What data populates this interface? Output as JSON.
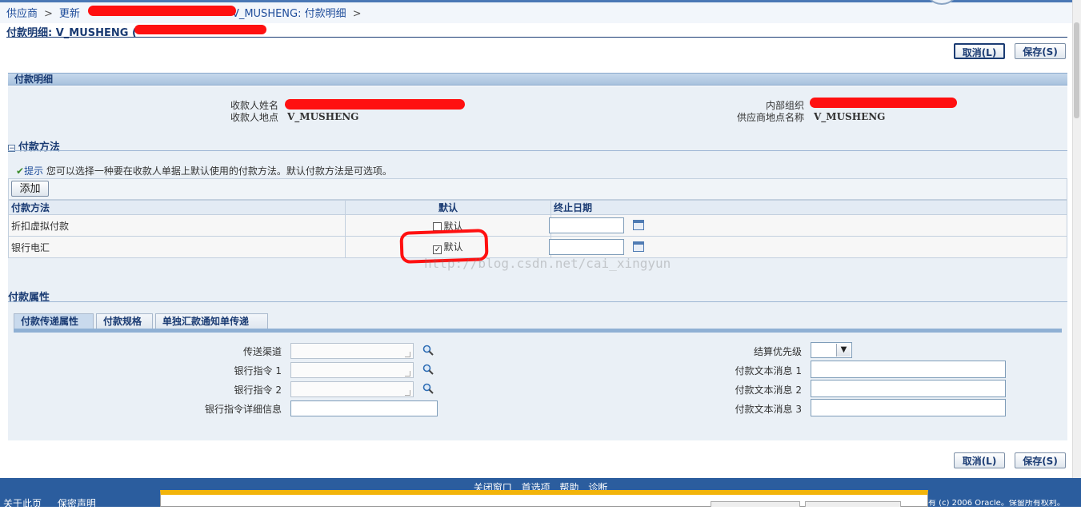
{
  "breadcrumb": {
    "items": [
      "供应商",
      "更新",
      "V_MUSHENG: 付款明细"
    ],
    "separator": ">"
  },
  "page": {
    "title": "付款明细: V_MUSHENG ("
  },
  "buttons": {
    "cancel": "取消(L)",
    "save": "保存(S)",
    "add": "添加"
  },
  "payment_detail": {
    "header": "付款明细",
    "payee_name_label": "收款人姓名",
    "payee_site_label": "收款人地点",
    "payee_site_value": "V_MUSHENG",
    "org_label": "内部组织",
    "supplier_site_label": "供应商地点名称",
    "supplier_site_value": "V_MUSHENG"
  },
  "payment_method": {
    "header": "付款方法",
    "tip_keyword": "提示",
    "tip_text": "您可以选择一种要在收款人单据上默认使用的付款方法。默认付款方法是可选项。",
    "columns": [
      "付款方法",
      "默认",
      "终止日期"
    ],
    "rows": [
      {
        "method": "折扣虚拟付款",
        "default_label": "默认",
        "checked": false
      },
      {
        "method": "银行电汇",
        "default_label": "默认",
        "checked": true
      }
    ]
  },
  "payment_attributes": {
    "header": "付款属性",
    "tabs": [
      "付款传递属性",
      "付款规格",
      "单独汇款通知单传递"
    ],
    "left_fields": [
      "传送渠道",
      "银行指令 1",
      "银行指令 2",
      "银行指令详细信息"
    ],
    "right_fields": [
      "结算优先级",
      "付款文本消息 1",
      "付款文本消息 2",
      "付款文本消息 3"
    ]
  },
  "footer": {
    "links": [
      "关闭窗口",
      "首选项",
      "帮助",
      "诊断"
    ],
    "left_links": [
      "关于此页",
      "保密声明"
    ],
    "copyright": "版权所有 (c) 2006 Oracle。保留所有权利。"
  },
  "watermark": "http://blog.csdn.net/cai_xingyun",
  "colors": {
    "accent": "#1a3b73",
    "section_header": "#c6d8ec",
    "footer": "#2b5d9e",
    "annotation": "#ff1010"
  }
}
